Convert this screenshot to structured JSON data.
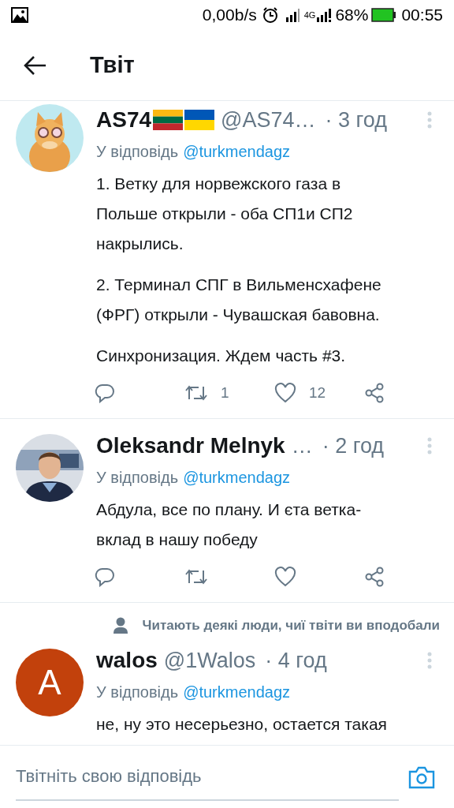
{
  "status_bar": {
    "network_speed": "0,00b/s",
    "network_type": "4G",
    "battery": "68%",
    "time": "00:55"
  },
  "header": {
    "title": "Твіт"
  },
  "tweets": [
    {
      "avatar": {
        "kind": "picture"
      },
      "name": "AS74",
      "name_flags": [
        {
          "stripes": [
            {
              "color": "#fdb913"
            },
            {
              "color": "#006a44"
            },
            {
              "color": "#c1272d"
            }
          ]
        },
        {
          "stripes": [
            {
              "color": "#0057b7"
            },
            {
              "color": "#ffd700"
            }
          ]
        }
      ],
      "handle": "@AS74…",
      "time": "· 3 год",
      "reply_prefix": "У відповідь",
      "reply_to": "@turkmendagz",
      "body": "1. Ветку для норвежского газа в\nПольше открыли - оба СП1и СП2\nнакрылись.\n\n2. Терминал СПГ в Вильменсхафене\n(ФРГ) открыли - Чувашская бавовна.\n\nСинхронизация. Ждем часть #3.",
      "actions_bar": true,
      "retweet_count": "1",
      "like_count": "12"
    },
    {
      "avatar": {
        "kind": "picture"
      },
      "name": "Oleksandr Melnyk",
      "handle": "…",
      "time": "· 2 год",
      "reply_prefix": "У відповідь",
      "reply_to": "@turkmendagz",
      "body": "Абдула, все по плану. И єта ветка-\nвклад в нашу победу",
      "actions_bar": true
    },
    {
      "social_context": "Читають деякі люди, чиї твіти ви вподобали",
      "avatar": {
        "kind": "letter",
        "letter": "A",
        "color": "#c2410c"
      },
      "name": "walos",
      "handle": "@1Walos",
      "time": "· 4 год",
      "reply_prefix": "У відповідь",
      "reply_to": "@turkmendagz",
      "body": "не, ну это несерьезно, остается такая"
    }
  ],
  "composer": {
    "placeholder": "Твітніть свою відповідь"
  }
}
